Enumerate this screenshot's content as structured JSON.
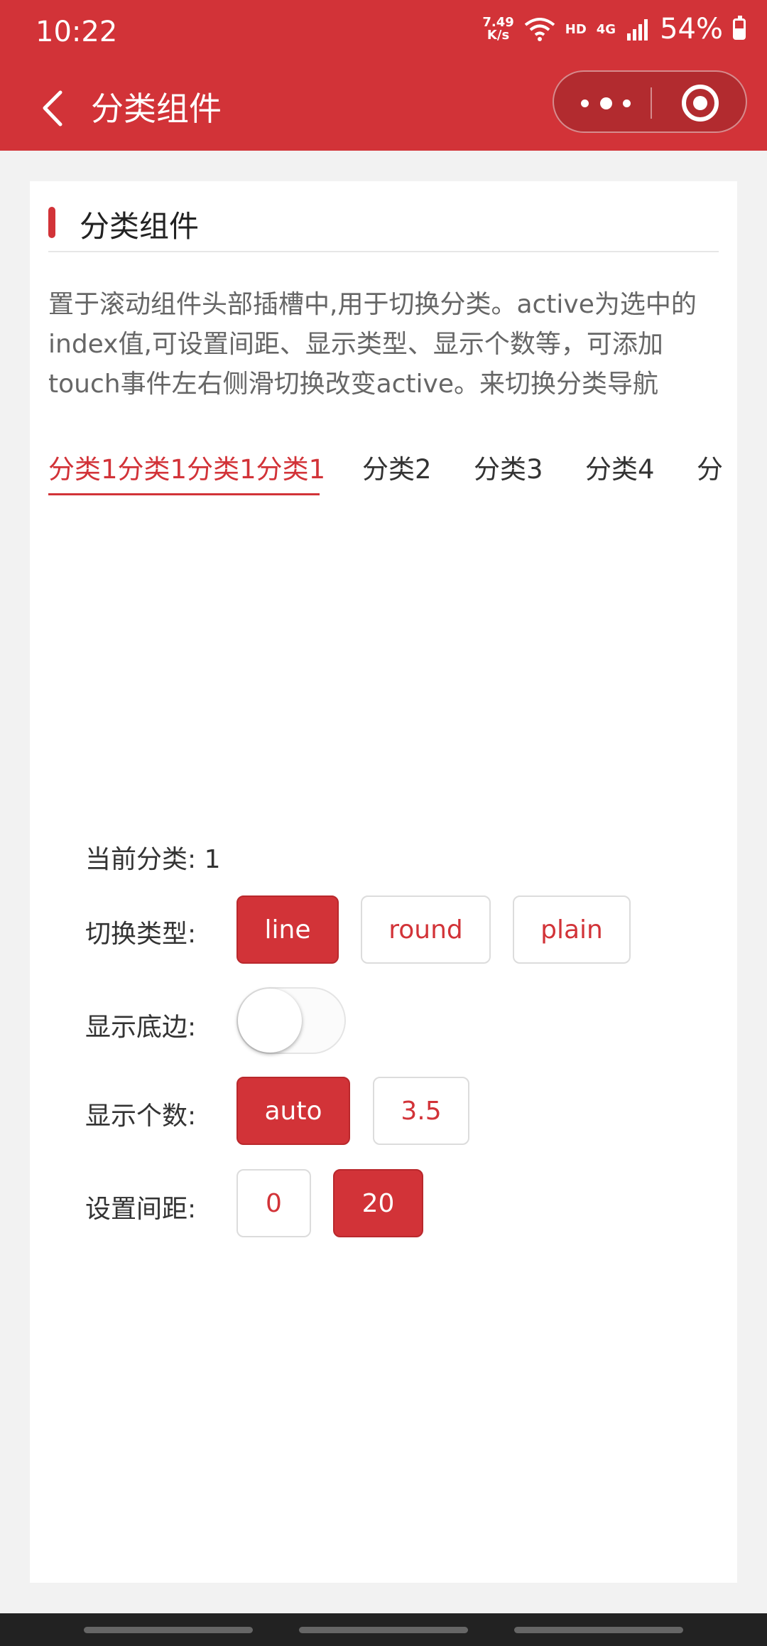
{
  "status_bar": {
    "time": "10:22",
    "speed_value": "7.49",
    "speed_unit": "K/s",
    "hd": "HD",
    "network": "4G",
    "battery": "54%"
  },
  "nav": {
    "title": "分类组件"
  },
  "card": {
    "title": "分类组件",
    "description": "置于滚动组件头部插槽中,用于切换分类。active为选中的index值,可设置间距、显示类型、显示个数等，可添加touch事件左右侧滑切换改变active。来切换分类导航"
  },
  "tabs": [
    {
      "label": "分类1分类1分类1分类1",
      "active": true
    },
    {
      "label": "分类2",
      "active": false
    },
    {
      "label": "分类3",
      "active": false
    },
    {
      "label": "分类4",
      "active": false
    },
    {
      "label": "分",
      "active": false
    }
  ],
  "controls": {
    "current_label": "当前分类: 1",
    "type_label": "切换类型:",
    "type_options": [
      "line",
      "round",
      "plain"
    ],
    "type_selected": "line",
    "border_label": "显示底边:",
    "border_on": false,
    "count_label": "显示个数:",
    "count_options": [
      "auto",
      "3.5"
    ],
    "count_selected": "auto",
    "gap_label": "设置间距:",
    "gap_options": [
      "0",
      "20"
    ],
    "gap_selected": "20"
  },
  "colors": {
    "accent": "#d23338"
  }
}
